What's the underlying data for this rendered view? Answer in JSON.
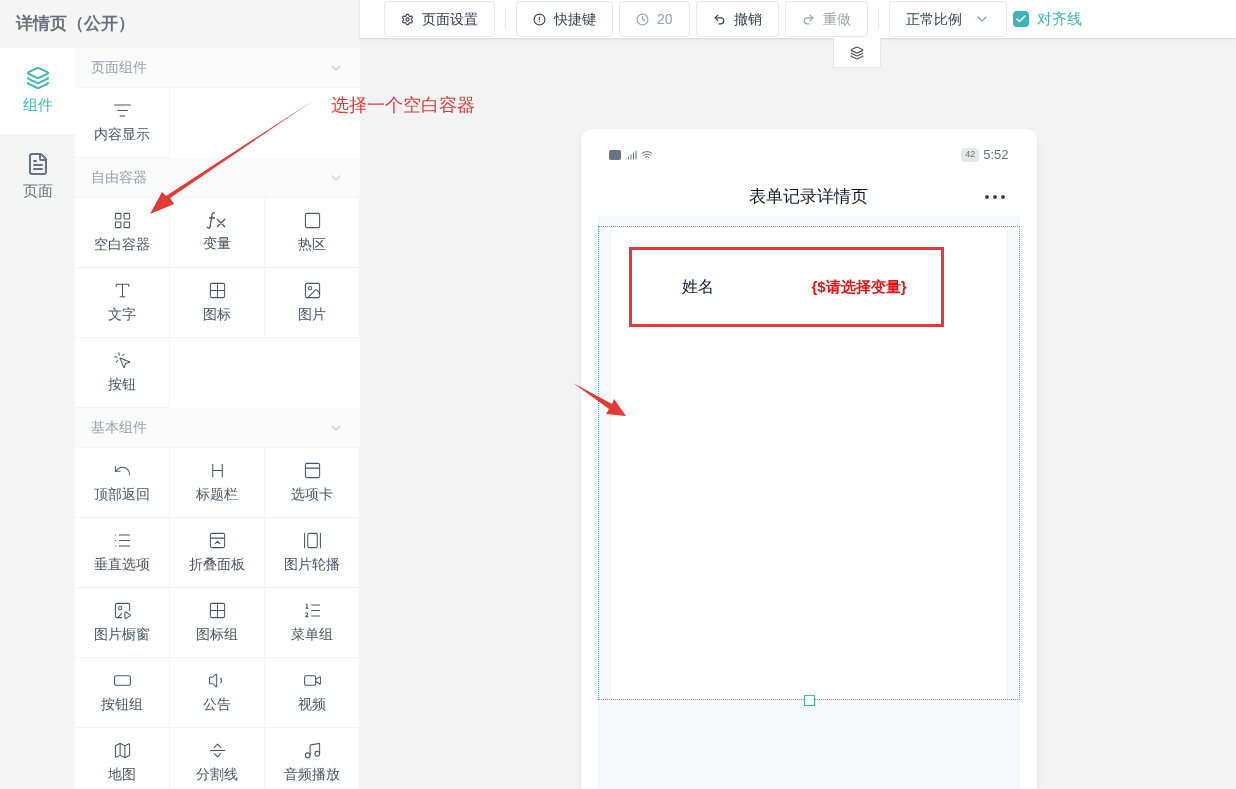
{
  "app_title": "详情页（公开）",
  "nav_tabs": [
    {
      "label": "组件",
      "selected": true
    },
    {
      "label": "页面",
      "selected": false
    }
  ],
  "sections": [
    {
      "title": "页面组件",
      "expanded": true,
      "items": [
        "内容显示"
      ]
    },
    {
      "title": "自由容器",
      "expanded": true,
      "items": [
        "空白容器",
        "变量",
        "热区",
        "文字",
        "图标",
        "图片",
        "按钮"
      ]
    },
    {
      "title": "基本组件",
      "expanded": true,
      "items": [
        "顶部返回",
        "标题栏",
        "选项卡",
        "垂直选项",
        "折叠面板",
        "图片轮播",
        "图片橱窗",
        "图标组",
        "菜单组",
        "按钮组",
        "公告",
        "视频",
        "地图",
        "分割线",
        "音频播放"
      ]
    }
  ],
  "toolbar": [
    {
      "kind": "button",
      "label": "页面设置",
      "disabled": false
    },
    {
      "kind": "separator"
    },
    {
      "kind": "button",
      "label": "快捷键",
      "disabled": false
    },
    {
      "kind": "button",
      "label": "20",
      "disabled": true
    },
    {
      "kind": "button",
      "label": "撤销",
      "disabled": false
    },
    {
      "kind": "button",
      "label": "重做",
      "disabled": true
    },
    {
      "kind": "separator"
    },
    {
      "kind": "select",
      "label": "正常比例"
    },
    {
      "kind": "checkbox",
      "label": "对齐线",
      "checked": true
    }
  ],
  "phone": {
    "battery": "42",
    "time": "5:52",
    "title": "表单记录详情页",
    "field": {
      "label": "姓名",
      "value": "{$请选择变量}"
    }
  },
  "annotation": {
    "text": "选择一个空白容器"
  }
}
